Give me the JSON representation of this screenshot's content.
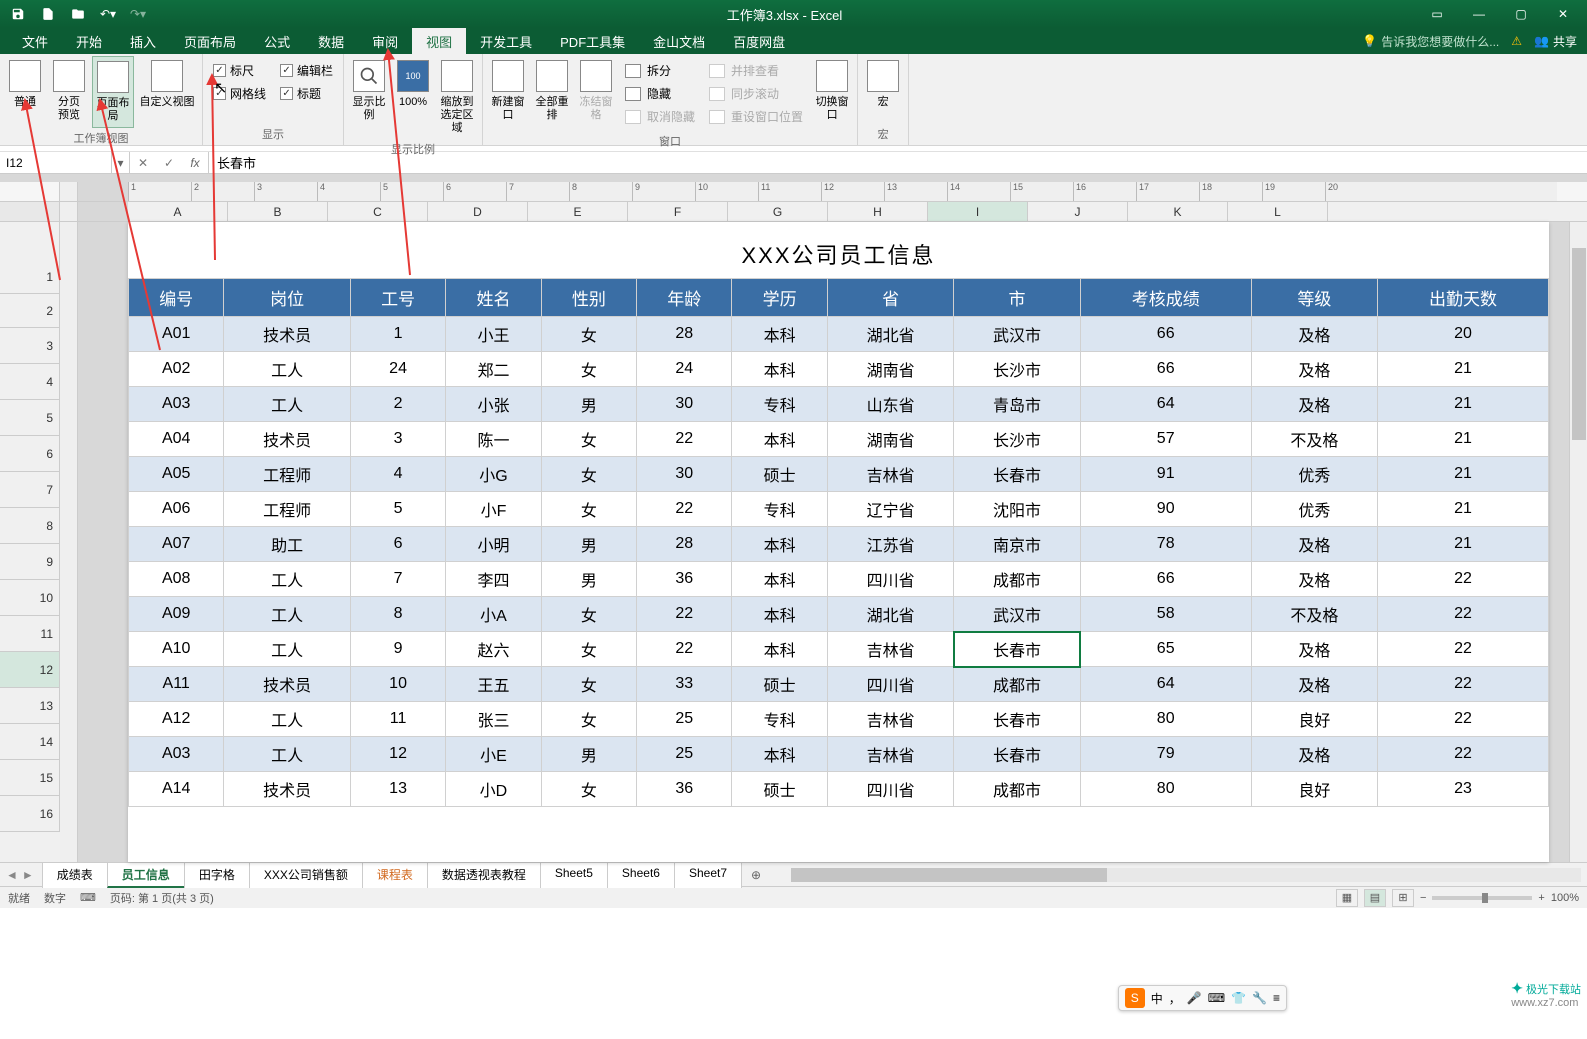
{
  "title_bar": {
    "filename": "工作簿3.xlsx - Excel",
    "share_label": "共享"
  },
  "menu": {
    "tabs": [
      "文件",
      "开始",
      "插入",
      "页面布局",
      "公式",
      "数据",
      "审阅",
      "视图",
      "开发工具",
      "PDF工具集",
      "金山文档",
      "百度网盘"
    ],
    "active_index": 7,
    "tell_me": "告诉我您想要做什么..."
  },
  "ribbon": {
    "views": {
      "normal": "普通",
      "page_break": "分页\n预览",
      "page_layout": "页面布局",
      "custom": "自定义视图",
      "group": "工作簿视图"
    },
    "show": {
      "ruler": "标尺",
      "gridlines": "网格线",
      "formula_bar": "编辑栏",
      "headings": "标题",
      "group": "显示"
    },
    "zoom": {
      "zoom": "显示比例",
      "hundred": "100%",
      "fit": "缩放到\n选定区域",
      "group": "显示比例"
    },
    "window": {
      "new": "新建窗口",
      "arrange": "全部重排",
      "freeze": "冻结窗格",
      "split": "拆分",
      "hide": "隐藏",
      "unhide": "取消隐藏",
      "side_by_side": "并排查看",
      "sync_scroll": "同步滚动",
      "reset_pos": "重设窗口位置",
      "switch": "切换窗口",
      "group": "窗口"
    },
    "macros": {
      "macros": "宏",
      "group": "宏"
    }
  },
  "name_box": "I12",
  "formula_value": "长春市",
  "columns": [
    "A",
    "B",
    "C",
    "D",
    "E",
    "F",
    "G",
    "H",
    "I",
    "J",
    "K",
    "L"
  ],
  "row_numbers": [
    1,
    2,
    3,
    4,
    5,
    6,
    7,
    8,
    9,
    10,
    11,
    12,
    13,
    14,
    15,
    16
  ],
  "sheet_title": "XXX公司员工信息",
  "headers": [
    "编号",
    "岗位",
    "工号",
    "姓名",
    "性别",
    "年龄",
    "学历",
    "省",
    "市",
    "考核成绩",
    "等级",
    "出勤天数"
  ],
  "rows": [
    [
      "A01",
      "技术员",
      "1",
      "小王",
      "女",
      "28",
      "本科",
      "湖北省",
      "武汉市",
      "66",
      "及格",
      "20"
    ],
    [
      "A02",
      "工人",
      "24",
      "郑二",
      "女",
      "24",
      "本科",
      "湖南省",
      "长沙市",
      "66",
      "及格",
      "21"
    ],
    [
      "A03",
      "工人",
      "2",
      "小张",
      "男",
      "30",
      "专科",
      "山东省",
      "青岛市",
      "64",
      "及格",
      "21"
    ],
    [
      "A04",
      "技术员",
      "3",
      "陈一",
      "女",
      "22",
      "本科",
      "湖南省",
      "长沙市",
      "57",
      "不及格",
      "21"
    ],
    [
      "A05",
      "工程师",
      "4",
      "小G",
      "女",
      "30",
      "硕士",
      "吉林省",
      "长春市",
      "91",
      "优秀",
      "21"
    ],
    [
      "A06",
      "工程师",
      "5",
      "小F",
      "女",
      "22",
      "专科",
      "辽宁省",
      "沈阳市",
      "90",
      "优秀",
      "21"
    ],
    [
      "A07",
      "助工",
      "6",
      "小明",
      "男",
      "28",
      "本科",
      "江苏省",
      "南京市",
      "78",
      "及格",
      "21"
    ],
    [
      "A08",
      "工人",
      "7",
      "李四",
      "男",
      "36",
      "本科",
      "四川省",
      "成都市",
      "66",
      "及格",
      "22"
    ],
    [
      "A09",
      "工人",
      "8",
      "小A",
      "女",
      "22",
      "本科",
      "湖北省",
      "武汉市",
      "58",
      "不及格",
      "22"
    ],
    [
      "A10",
      "工人",
      "9",
      "赵六",
      "女",
      "22",
      "本科",
      "吉林省",
      "长春市",
      "65",
      "及格",
      "22"
    ],
    [
      "A11",
      "技术员",
      "10",
      "王五",
      "女",
      "33",
      "硕士",
      "四川省",
      "成都市",
      "64",
      "及格",
      "22"
    ],
    [
      "A12",
      "工人",
      "11",
      "张三",
      "女",
      "25",
      "专科",
      "吉林省",
      "长春市",
      "80",
      "良好",
      "22"
    ],
    [
      "A03",
      "工人",
      "12",
      "小E",
      "男",
      "25",
      "本科",
      "吉林省",
      "长春市",
      "79",
      "及格",
      "22"
    ],
    [
      "A14",
      "技术员",
      "13",
      "小D",
      "女",
      "36",
      "硕士",
      "四川省",
      "成都市",
      "80",
      "良好",
      "23"
    ]
  ],
  "active_cell": {
    "row": 9,
    "col": 8
  },
  "sheet_tabs": {
    "tabs": [
      "成绩表",
      "员工信息",
      "田字格",
      "XXX公司销售额",
      "课程表",
      "数据透视表教程",
      "Sheet5",
      "Sheet6",
      "Sheet7"
    ],
    "active_index": 1,
    "orange_index": 4
  },
  "status": {
    "ready": "就绪",
    "mode": "数字",
    "page_info": "页码: 第 1 页(共 3 页)",
    "zoom": "100%"
  },
  "ime": {
    "lang": "中"
  },
  "watermark_site": "www.xz7.com",
  "watermark_brand": "极光下载站",
  "ruler_ticks": [
    "1",
    "2",
    "3",
    "4",
    "5",
    "6",
    "7",
    "8",
    "9",
    "10",
    "11",
    "12",
    "13",
    "14",
    "15",
    "16",
    "17",
    "18",
    "19",
    "20"
  ],
  "chart_data": {
    "type": "table",
    "title": "XXX公司员工信息",
    "columns": [
      "编号",
      "岗位",
      "工号",
      "姓名",
      "性别",
      "年龄",
      "学历",
      "省",
      "市",
      "考核成绩",
      "等级",
      "出勤天数"
    ],
    "data": [
      [
        "A01",
        "技术员",
        1,
        "小王",
        "女",
        28,
        "本科",
        "湖北省",
        "武汉市",
        66,
        "及格",
        20
      ],
      [
        "A02",
        "工人",
        24,
        "郑二",
        "女",
        24,
        "本科",
        "湖南省",
        "长沙市",
        66,
        "及格",
        21
      ],
      [
        "A03",
        "工人",
        2,
        "小张",
        "男",
        30,
        "专科",
        "山东省",
        "青岛市",
        64,
        "及格",
        21
      ],
      [
        "A04",
        "技术员",
        3,
        "陈一",
        "女",
        22,
        "本科",
        "湖南省",
        "长沙市",
        57,
        "不及格",
        21
      ],
      [
        "A05",
        "工程师",
        4,
        "小G",
        "女",
        30,
        "硕士",
        "吉林省",
        "长春市",
        91,
        "优秀",
        21
      ],
      [
        "A06",
        "工程师",
        5,
        "小F",
        "女",
        22,
        "专科",
        "辽宁省",
        "沈阳市",
        90,
        "优秀",
        21
      ],
      [
        "A07",
        "助工",
        6,
        "小明",
        "男",
        28,
        "本科",
        "江苏省",
        "南京市",
        78,
        "及格",
        21
      ],
      [
        "A08",
        "工人",
        7,
        "李四",
        "男",
        36,
        "本科",
        "四川省",
        "成都市",
        66,
        "及格",
        22
      ],
      [
        "A09",
        "工人",
        8,
        "小A",
        "女",
        22,
        "本科",
        "湖北省",
        "武汉市",
        58,
        "不及格",
        22
      ],
      [
        "A10",
        "工人",
        9,
        "赵六",
        "女",
        22,
        "本科",
        "吉林省",
        "长春市",
        65,
        "及格",
        22
      ],
      [
        "A11",
        "技术员",
        10,
        "王五",
        "女",
        33,
        "硕士",
        "四川省",
        "成都市",
        64,
        "及格",
        22
      ],
      [
        "A12",
        "工人",
        11,
        "张三",
        "女",
        25,
        "专科",
        "吉林省",
        "长春市",
        80,
        "良好",
        22
      ],
      [
        "A03",
        "工人",
        12,
        "小E",
        "男",
        25,
        "本科",
        "吉林省",
        "长春市",
        79,
        "及格",
        22
      ],
      [
        "A14",
        "技术员",
        13,
        "小D",
        "女",
        36,
        "硕士",
        "四川省",
        "成都市",
        80,
        "良好",
        23
      ]
    ]
  }
}
